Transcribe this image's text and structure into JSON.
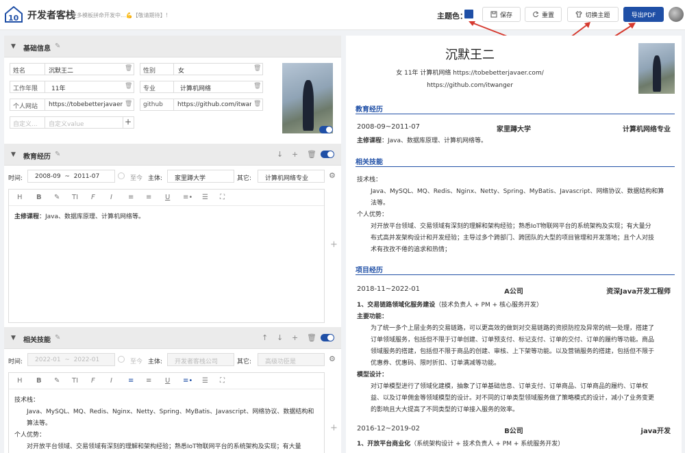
{
  "app": {
    "title": "开发者客栈",
    "subtitle": "更多模板拼命开发中...💪【敬请期待】！"
  },
  "topbar": {
    "theme_label": "主题色：",
    "theme_color": "#1f4fa6",
    "save": "保存",
    "reset": "重置",
    "switch_theme": "切换主题",
    "export_pdf": "导出PDF"
  },
  "basic": {
    "title": "基础信息",
    "fields": [
      {
        "k": "姓名",
        "v": "沉默王二"
      },
      {
        "k": "性别",
        "v": "女"
      },
      {
        "k": "工作年限",
        "v": "11年"
      },
      {
        "k": "专业",
        "v": "计算机网络"
      },
      {
        "k": "个人网站",
        "v": "https://tobebetterjavaer.com/"
      },
      {
        "k": "github",
        "v": "https://github.com/itwanger"
      }
    ],
    "custom_key_ph": "自定义...",
    "custom_value_ph": "自定义value"
  },
  "edu": {
    "title": "教育经历",
    "time_label": "时间:",
    "start": "2008-09",
    "tilde": "~",
    "end": "2011-07",
    "now_label": "至今",
    "body_label": "主体:",
    "body_value": "家里蹲大学",
    "other_label": "其它:",
    "other_value": "计算机网络专业",
    "content_bold": "主修课程",
    "content": "：Java、数据库原理、计算机网络等。"
  },
  "skills": {
    "title": "相关技能",
    "time_label": "时间:",
    "start": "2022-01",
    "tilde": "~",
    "end": "2022-01",
    "now_label": "至今",
    "body_label": "主体:",
    "body_ph": "开发者客栈公司",
    "other_label": "其它:",
    "other_ph": "高级功臣是",
    "stack_label": "技术栈：",
    "stack_line1": "Java、MySQL、MQ、Redis、Nginx、Netty、Spring、MyBatis、Javascript、网络协议、数据结构和",
    "stack_line2": "算法等。",
    "adv_label": "个人优势：",
    "adv_line1": "对开放平台领域、交易领域有深刻的理解和架构经验；熟悉IoT物联网平台的系统架构及实现；有大量"
  },
  "toolbar_icons": [
    "H",
    "B",
    "✎",
    "TI",
    "F",
    "I",
    "≡",
    "≡",
    "U",
    "≡•",
    "☰",
    "⛶"
  ],
  "resume": {
    "name": "沉默王二",
    "info1": "女   11年   计算机网络   https://tobebetterjavaer.com/",
    "info2": "https://github.com/itwanger",
    "sec_edu": "教育经历",
    "edu_time": "2008-09~2011-07",
    "edu_org": "家里蹲大学",
    "edu_major": "计算机网络专业",
    "edu_course_b": "主修课程",
    "edu_course": "：Java、数据库原理、计算机网络等。",
    "sec_skills": "相关技能",
    "stack_label": "技术栈：",
    "stack_1": "Java、MySQL、MQ、Redis、Nginx、Netty、Spring、MyBatis、Javascript、网络协议、数据结构和算",
    "stack_2": "法等。",
    "adv_label": "个人优势：",
    "adv_1": "对开放平台领域、交易领域有深刻的理解和架构经验；熟悉IoT物联网平台的系统架构及实现；有大量分",
    "adv_2": "布式高并发架构设计和开发经验；主导过多个跨部门、跨团队的大型的项目管理和开发落地；且个人对技",
    "adv_3": "术有孜孜不倦的追求和热情；",
    "sec_proj": "项目经历",
    "p1_time": "2018-11~2022-01",
    "p1_org": "A公司",
    "p1_role": "资深Java开发工程师",
    "p1_item": "1、交易链路领域化服务建设",
    "p1_item_note": "（技术负责人 + PM + 核心服务开发）",
    "p1_main_label": "主要功能：",
    "p1_main_1": "为了统一多个上层业务的交易链路，可以更高效的做到对交易链路的资损防控及异常的统一处理，搭建了",
    "p1_main_2": "订单领域服务，包括但不限于订单创建、订单预支付、标记支付、订单的交付、订单的履约等功能。商品",
    "p1_main_3": "领域服务的搭建，包括但不限于商品的创建、审核、上下架等功能。以及营销服务的搭建，包括但不限于",
    "p1_main_4": "优惠券、优惠码、限时折扣、订单满减等功能。",
    "p1_model_label": "模型设计：",
    "p1_model_1": "对订单模型进行了领域化建模，抽象了订单基础信息、订单支付、订单商品、订单商品的履约、订单权",
    "p1_model_2": "益、以及订单佣金等领域模型的设计。对不同的订单类型领域服务做了策略模式的设计，减小了业务变更",
    "p1_model_3": "的影响且大大提高了不同类型的订单接入服务的效率。",
    "p2_time": "2016-12~2019-02",
    "p2_org": "B公司",
    "p2_role": "java开发",
    "p2_item": "1、开放平台商业化",
    "p2_item_note": "（系统架构设计 + 技术负责人 + PM + 系统服务开发）"
  }
}
